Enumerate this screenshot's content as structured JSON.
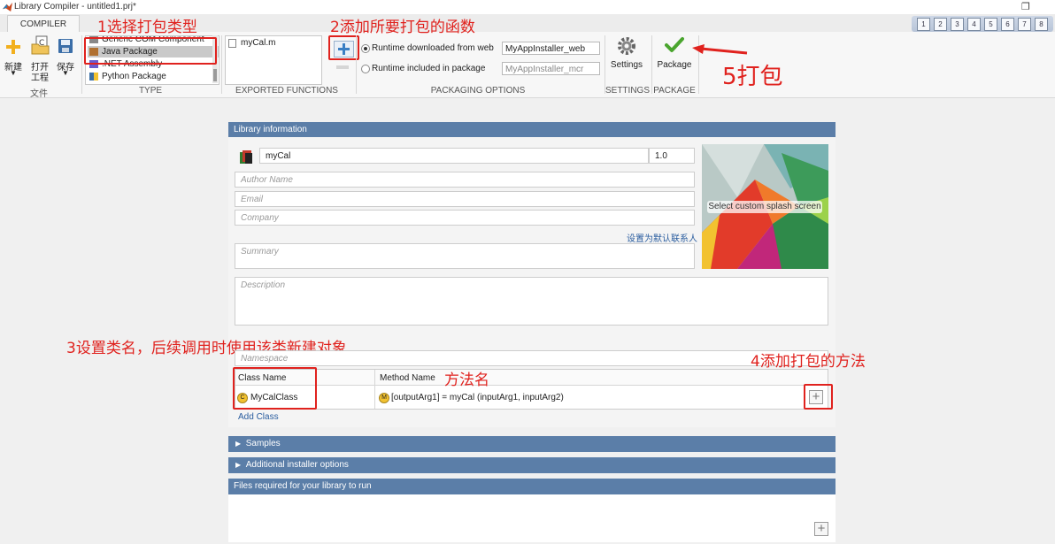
{
  "window": {
    "title": "Library Compiler - untitled1.prj*",
    "restore_glyph": "❐"
  },
  "tabs": {
    "compiler": "COMPILER"
  },
  "quick_access": [
    "1",
    "2",
    "3",
    "4",
    "5",
    "6",
    "7",
    "8"
  ],
  "toolstrip": {
    "file": {
      "new": "新建",
      "open_line1": "打开",
      "open_line2": "工程",
      "save": "保存",
      "section": "文件"
    },
    "type": {
      "section": "TYPE",
      "items": [
        "Generic COM Component",
        "Java Package",
        ".NET Assembly",
        "Python Package"
      ],
      "selected": "Java Package"
    },
    "exported": {
      "section": "EXPORTED FUNCTIONS",
      "files": [
        "myCal.m"
      ]
    },
    "packaging": {
      "section": "PACKAGING OPTIONS",
      "web_label": "Runtime downloaded from web",
      "web_value": "MyAppInstaller_web",
      "included_label": "Runtime included in package",
      "included_value": "MyAppInstaller_mcr"
    },
    "settings": {
      "label": "Settings",
      "section": "SETTINGS"
    },
    "package": {
      "label": "Package",
      "section": "PACKAGE"
    }
  },
  "annotations": {
    "step1": "1选择打包类型",
    "step2": "2添加所要打包的函数",
    "step3": "3设置类名，后续调用时使用该类新建对象",
    "step4": "4添加打包的方法",
    "step5": "5打包",
    "method_name": "方法名"
  },
  "library_info": {
    "header": "Library information",
    "name": "myCal",
    "version": "1.0",
    "author_placeholder": "Author Name",
    "email_placeholder": "Email",
    "company_placeholder": "Company",
    "set_default_contact": "设置为默认联系人",
    "summary_placeholder": "Summary",
    "description_placeholder": "Description",
    "splash_label": "Select custom splash screen",
    "namespace_placeholder": "Namespace"
  },
  "class_table": {
    "class_header": "Class Name",
    "method_header": "Method Name",
    "rows": [
      {
        "class": "MyCalClass",
        "method": "[outputArg1] = myCal (inputArg1, inputArg2)"
      }
    ],
    "add_class": "Add Class"
  },
  "sections": {
    "samples": "Samples",
    "additional": "Additional installer options",
    "files_required": "Files required for your library to run"
  },
  "colors": {
    "annotation": "#e0221e",
    "section_header": "#5b7ea8",
    "link": "#2a5d9f"
  }
}
